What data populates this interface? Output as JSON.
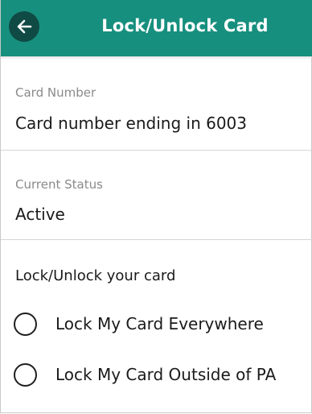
{
  "header": {
    "title": "Lock/Unlock Card",
    "back_icon": "arrow-left-icon",
    "color": "#178f7e"
  },
  "card_number": {
    "label": "Card Number",
    "value": "Card number ending in 6003"
  },
  "current_status": {
    "label": "Current Status",
    "value": "Active"
  },
  "lock_section": {
    "heading": "Lock/Unlock your card",
    "options": [
      {
        "label": "Lock My Card Everywhere",
        "selected": false
      },
      {
        "label": "Lock My Card Outside of PA",
        "selected": false
      }
    ]
  }
}
